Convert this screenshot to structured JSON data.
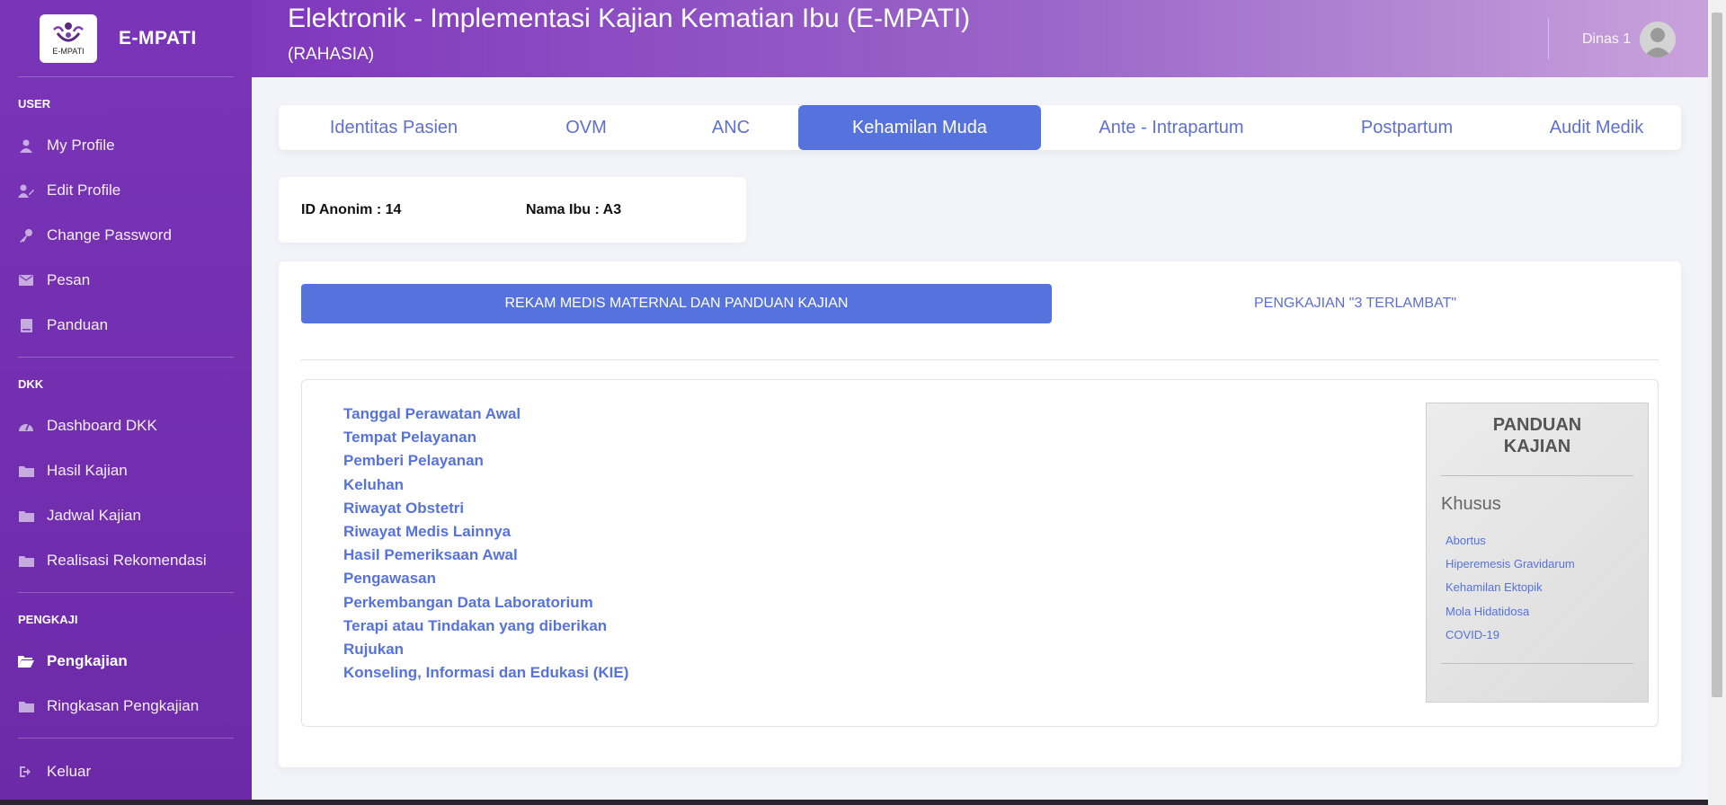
{
  "brand": {
    "name": "E-MPATI",
    "logo_caption": "E-MPATI"
  },
  "sidebar": {
    "sections": [
      {
        "heading": "USER",
        "items": [
          {
            "label": "My Profile",
            "icon": "user-icon"
          },
          {
            "label": "Edit Profile",
            "icon": "user-edit-icon"
          },
          {
            "label": "Change Password",
            "icon": "key-icon"
          },
          {
            "label": "Pesan",
            "icon": "envelope-icon"
          },
          {
            "label": "Panduan",
            "icon": "book-icon"
          }
        ]
      },
      {
        "heading": "DKK",
        "items": [
          {
            "label": "Dashboard DKK",
            "icon": "dashboard-icon"
          },
          {
            "label": "Hasil Kajian",
            "icon": "folder-icon"
          },
          {
            "label": "Jadwal Kajian",
            "icon": "folder-icon"
          },
          {
            "label": "Realisasi Rekomendasi",
            "icon": "folder-icon"
          }
        ]
      },
      {
        "heading": "PENGKAJI",
        "items": [
          {
            "label": "Pengkajian",
            "icon": "folder-open-icon",
            "active": true
          },
          {
            "label": "Ringkasan Pengkajian",
            "icon": "folder-icon"
          }
        ]
      }
    ],
    "logout": {
      "label": "Keluar",
      "icon": "sign-out-icon"
    }
  },
  "header": {
    "title": "Elektronik - Implementasi Kajian Kematian Ibu (E-MPATI)",
    "subtitle": "(RAHASIA)",
    "user_name": "Dinas 1"
  },
  "tabs": [
    {
      "label": "Identitas Pasien"
    },
    {
      "label": "OVM"
    },
    {
      "label": "ANC"
    },
    {
      "label": "Kehamilan Muda",
      "active": true
    },
    {
      "label": "Ante - Intrapartum"
    },
    {
      "label": "Postpartum"
    },
    {
      "label": "Audit Medik"
    }
  ],
  "patient": {
    "id_anonim": "ID Anonim : 14",
    "nama_ibu": "Nama Ibu : A3"
  },
  "subtabs": {
    "active_label": "REKAM MEDIS MATERNAL DAN PANDUAN KAJIAN",
    "other_label": "PENGKAJIAN \"3 TERLAMBAT\""
  },
  "record_links": [
    "Tanggal Perawatan Awal",
    "Tempat Pelayanan",
    "Pemberi Pelayanan",
    "Keluhan",
    "Riwayat Obstetri",
    "Riwayat Medis Lainnya",
    "Hasil Pemeriksaan Awal",
    "Pengawasan",
    "Perkembangan Data Laboratorium",
    "Terapi atau Tindakan yang diberikan",
    "Rujukan",
    "Konseling, Informasi dan Edukasi (KIE)"
  ],
  "panduan": {
    "title_line1": "PANDUAN",
    "title_line2": "KAJIAN",
    "subtitle": "Khusus",
    "links": [
      "Abortus",
      "Hiperemesis Gravidarum",
      "Kehamilan Ektopik",
      "Mola Hidatidosa",
      "COVID-19"
    ]
  },
  "colors": {
    "accent": "#5672dd",
    "sidebar": "#7a34b8"
  }
}
